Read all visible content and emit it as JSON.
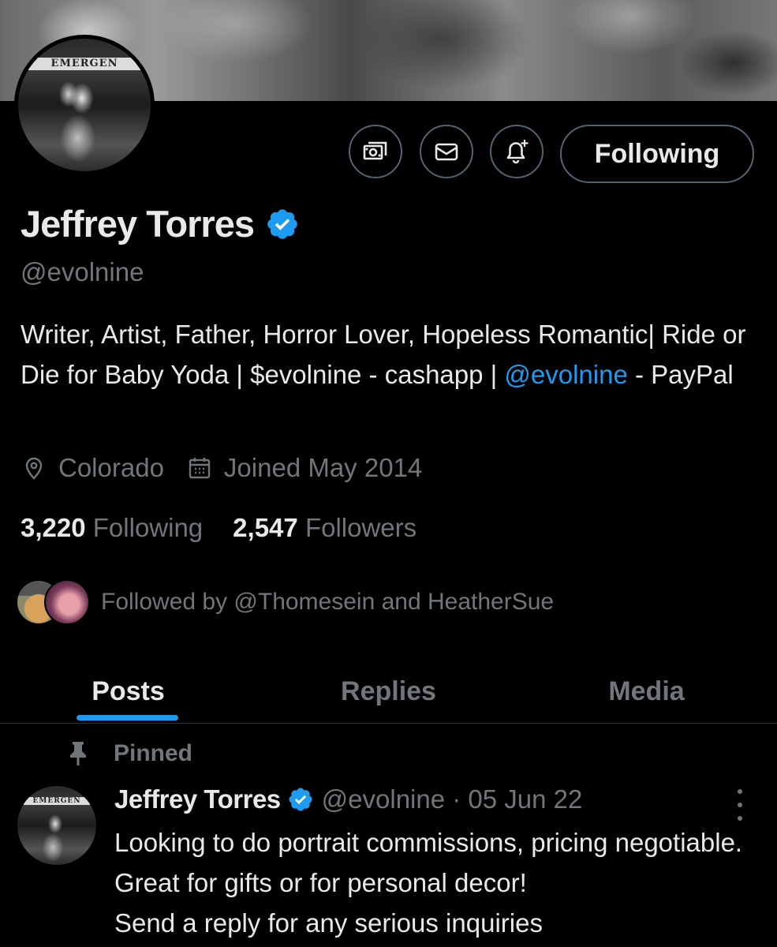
{
  "profile": {
    "name": "Jeffrey Torres",
    "handle": "@evolnine",
    "bio_part1": "Writer, Artist, Father, Horror Lover, Hopeless Romantic| Ride or Die for Baby Yoda | $evolnine - cashapp | ",
    "bio_link": "@evolnine",
    "bio_part2": " - PayPal",
    "location": "Colorado",
    "joined": "Joined May 2014",
    "following_count": "3,220",
    "following_label": "Following",
    "followers_count": "2,547",
    "followers_label": "Followers",
    "followed_by": "Followed by @Thomesein and HeatherSue",
    "avatar_sign_text": "EMERGEN"
  },
  "actions": {
    "following_button": "Following",
    "icons": [
      "money-icon",
      "mail-icon",
      "bell-plus-icon"
    ]
  },
  "tabs": [
    {
      "label": "Posts",
      "active": true
    },
    {
      "label": "Replies",
      "active": false
    },
    {
      "label": "Media",
      "active": false
    }
  ],
  "pinned_post": {
    "pinned_label": "Pinned",
    "author": "Jeffrey Torres",
    "handle_date": "@evolnine · 05 Jun 22",
    "text": "Looking to do portrait commissions, pricing negotiable.  Great for gifts or for personal decor!\nSend a reply for any serious inquiries"
  },
  "colors": {
    "accent": "#1d9bf0",
    "muted": "#71767b",
    "text": "#e7e9ea",
    "border": "#536471",
    "background": "#000000"
  }
}
